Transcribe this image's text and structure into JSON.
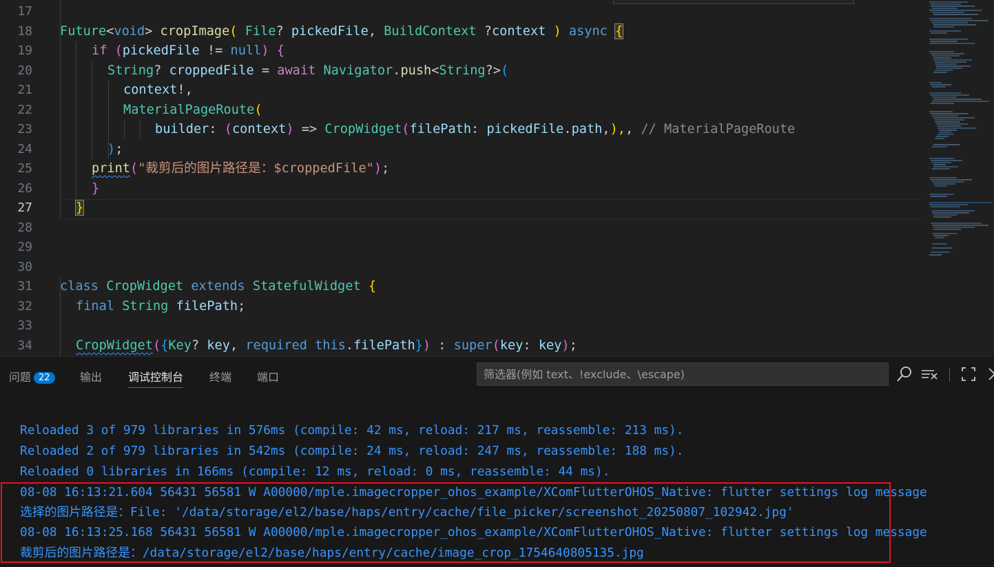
{
  "editor": {
    "active_line": "27",
    "lines": [
      {
        "n": "17"
      },
      {
        "n": "18",
        "t": [
          "Future",
          "<",
          "void",
          "> ",
          "cropImage",
          "( ",
          "File",
          "? ",
          "pickedFile",
          ", ",
          "BuildContext",
          " ?",
          "context",
          " ) ",
          "async",
          " ",
          "{"
        ]
      },
      {
        "n": "19",
        "t": [
          "if",
          " (",
          "pickedFile",
          " != ",
          "null",
          ") ",
          "{"
        ]
      },
      {
        "n": "20",
        "t": [
          "String",
          "? ",
          "croppedFile",
          " = ",
          "await",
          " ",
          "Navigator",
          ".",
          "push",
          "<",
          "String",
          "?>",
          "("
        ]
      },
      {
        "n": "21",
        "t": [
          "context",
          "!,"
        ]
      },
      {
        "n": "22",
        "t": [
          "MaterialPageRoute",
          "("
        ]
      },
      {
        "n": "23",
        "t": [
          "builder",
          ": ",
          "(",
          "context",
          ")",
          " => ",
          "CropWidget",
          "(",
          "filePath",
          ": ",
          "pickedFile",
          ".",
          "path",
          ",",
          "),",
          ", ",
          "// MaterialPageRoute"
        ]
      },
      {
        "n": "24",
        "t": [
          ")",
          ";"
        ]
      },
      {
        "n": "25",
        "t": [
          "print",
          "(",
          "\"裁剪后的图片路径是：$croppedFile\"",
          ")",
          ";"
        ]
      },
      {
        "n": "26",
        "t": [
          "}"
        ]
      },
      {
        "n": "27",
        "t": [
          "}"
        ]
      },
      {
        "n": "28"
      },
      {
        "n": "29"
      },
      {
        "n": "30"
      },
      {
        "n": "31",
        "t": [
          "class",
          " ",
          "CropWidget",
          " ",
          "extends",
          " ",
          "StatefulWidget",
          " ",
          "{"
        ]
      },
      {
        "n": "32",
        "t": [
          "final",
          " ",
          "String",
          " ",
          "filePath",
          ";"
        ]
      },
      {
        "n": "33"
      },
      {
        "n": "34",
        "t": [
          "CropWidget",
          "(",
          "{",
          "Key",
          "? ",
          "key",
          ", ",
          "required",
          " ",
          "this",
          ".",
          "filePath",
          "}",
          ")",
          " : ",
          "super",
          "(",
          "key",
          ": ",
          "key",
          ")",
          ";"
        ]
      }
    ]
  },
  "panel": {
    "tabs": {
      "problems": "问题",
      "problems_count": "22",
      "output": "输出",
      "debug_console": "调试控制台",
      "terminal": "终端",
      "ports": "端口"
    },
    "filter_placeholder": "筛选器(例如 text、!exclude、\\escape)",
    "icons": [
      "search-icon",
      "clear-list-icon",
      "maximize-icon",
      "close-icon"
    ]
  },
  "console": {
    "lines": [
      "Reloaded 3 of 979 libraries in 576ms (compile: 42 ms, reload: 217 ms, reassemble: 213 ms).",
      "Reloaded 2 of 979 libraries in 542ms (compile: 24 ms, reload: 247 ms, reassemble: 188 ms).",
      "Reloaded 0 libraries in 166ms (compile: 12 ms, reload: 0 ms, reassemble: 44 ms).",
      "08-08 16:13:21.604 56431 56581 W A00000/mple.imagecropper_ohos_example/XComFlutterOHOS_Native: flutter settings log message",
      "选择的图片路径是：File: '/data/storage/el2/base/haps/entry/cache/file_picker/screenshot_20250807_102942.jpg'",
      "08-08 16:13:25.168 56431 56581 W A00000/mple.imagecropper_ohos_example/XComFlutterOHOS_Native: flutter settings log message",
      "裁剪后的图片路径是：/data/storage/el2/base/haps/entry/cache/image_crop_1754640805135.jpg"
    ]
  },
  "colors": {
    "editor_bg": "#1f1f1f",
    "panel_bg": "#181818",
    "accent": "#0078d4",
    "console_text": "#3794ff",
    "highlight_box": "#e81123"
  }
}
